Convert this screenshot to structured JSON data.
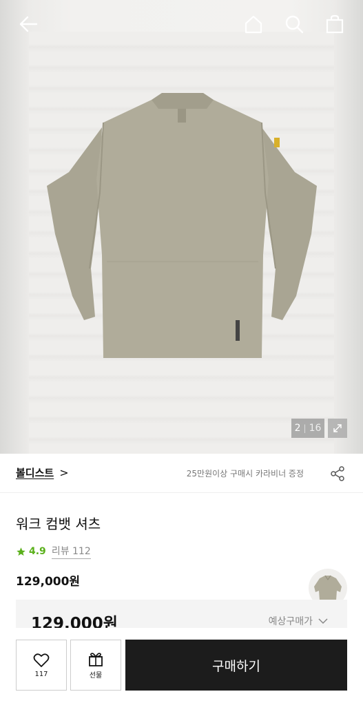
{
  "hero": {
    "image_counter": {
      "current": "2",
      "separator": "|",
      "total": "16"
    }
  },
  "icons": {
    "back": "arrow-left-icon",
    "home": "home-icon",
    "search": "search-icon",
    "cart": "shopping-bag-icon",
    "expand": "expand-icon",
    "share": "share-icon",
    "star": "star-icon",
    "heart": "heart-icon",
    "gift": "gift-icon",
    "chevron": "chevron-down-icon"
  },
  "brand": {
    "name": "볼디스트",
    "arrow": ">",
    "promo": "25만원이상 구매시 카라비너 증정"
  },
  "product": {
    "title": "워크 컴뱃 셔츠",
    "rating": "4.9",
    "review_label": "리뷰 112",
    "price": "129,000원"
  },
  "expected": {
    "price": "129,000원",
    "label": "예상구매가"
  },
  "bottom": {
    "like_count": "117",
    "gift_label": "선물",
    "buy_label": "구매하기"
  },
  "colors": {
    "accent_green": "#5ab01b",
    "buy_button": "#1c1c1c"
  }
}
